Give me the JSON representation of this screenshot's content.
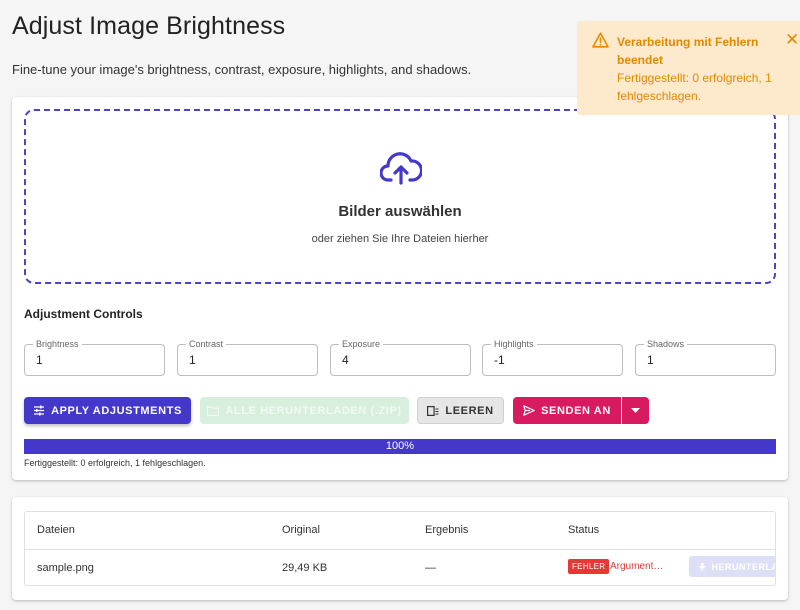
{
  "header": {
    "title": "Adjust Image Brightness",
    "subtitle": "Fine-tune your image's brightness, contrast, exposure, highlights, and shadows."
  },
  "dropzone": {
    "icon": "cloud-upload-icon",
    "title": "Bilder auswählen",
    "subtitle": "oder ziehen Sie Ihre Dateien hierher"
  },
  "controls": {
    "section_label": "Adjustment Controls",
    "fields": [
      {
        "label": "Brightness",
        "value": "1"
      },
      {
        "label": "Contrast",
        "value": "1"
      },
      {
        "label": "Exposure",
        "value": "4"
      },
      {
        "label": "Highlights",
        "value": "-1"
      },
      {
        "label": "Shadows",
        "value": "1"
      }
    ]
  },
  "actions": {
    "apply_label": "APPLY ADJUSTMENTS",
    "download_all_label": "ALLE HERUNTERLADEN (.ZIP)",
    "clear_label": "LEEREN",
    "send_label": "SENDEN AN"
  },
  "progress": {
    "percent": 100,
    "label": "100%",
    "status": "Fertiggestellt: 0 erfolgreich, 1 fehlgeschlagen."
  },
  "table": {
    "headers": [
      "Dateien",
      "Original",
      "Ergebnis",
      "Status"
    ],
    "rows": [
      {
        "file": "sample.png",
        "original": "29,49 KB",
        "result": "—",
        "status_badge": "FEHLER",
        "status_text": "Argument…",
        "download_label": "HERUNTERLADEN"
      }
    ]
  },
  "toast": {
    "title": "Verarbeitung mit Fehlern beendet",
    "message": "Fertiggestellt: 0 erfolgreich, 1 fehlgeschlagen.",
    "icon": "warning-icon",
    "close_icon": "close-icon"
  },
  "colors": {
    "primary": "#4338ca",
    "accent": "#d81b60",
    "error": "#e53935",
    "warning": "#e08a00",
    "warning_bg": "#fde9cb"
  }
}
